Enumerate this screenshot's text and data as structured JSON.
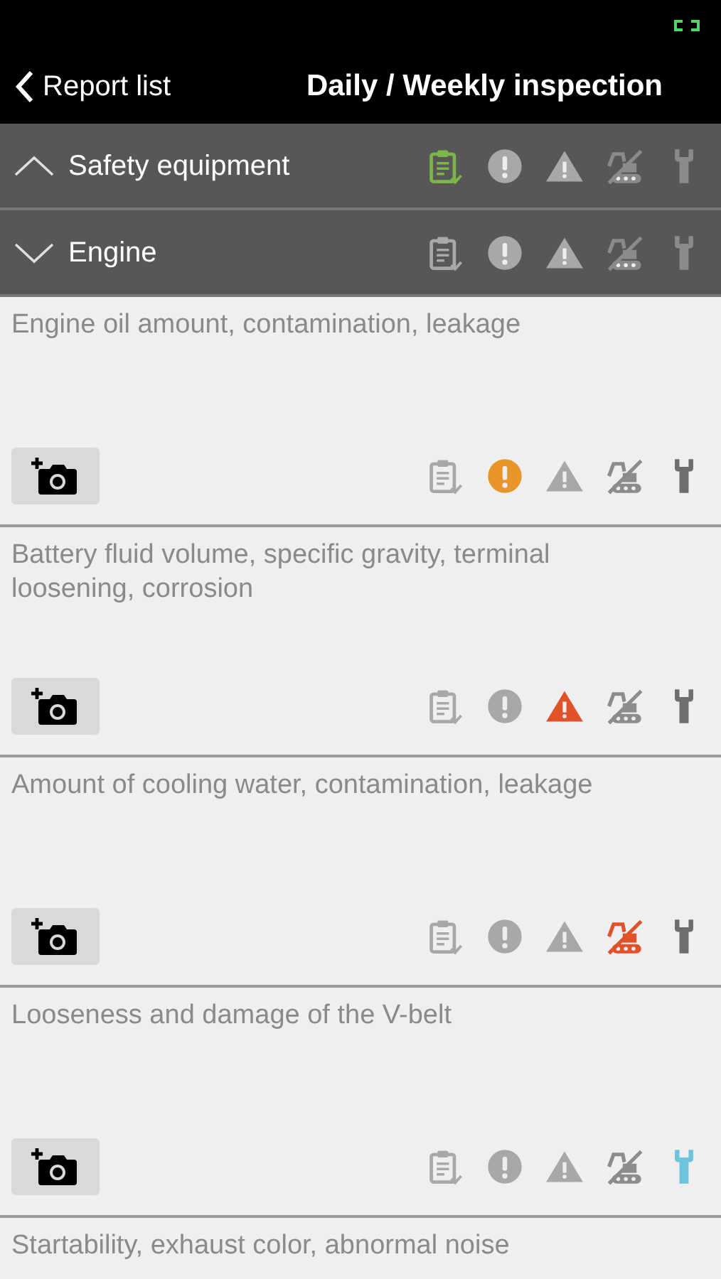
{
  "nav": {
    "back": "Report list",
    "title": "Daily / Weekly inspection"
  },
  "sections": [
    {
      "title": "Safety equipment",
      "expanded": true,
      "indicators": [
        {
          "kind": "ok",
          "selected": true
        },
        {
          "kind": "note",
          "selected": false
        },
        {
          "kind": "warning",
          "selected": false
        },
        {
          "kind": "out_of_service",
          "selected": false
        },
        {
          "kind": "repair",
          "selected": false
        }
      ]
    },
    {
      "title": "Engine",
      "expanded": false,
      "indicators": [
        {
          "kind": "ok",
          "selected": false
        },
        {
          "kind": "note",
          "selected": false
        },
        {
          "kind": "warning",
          "selected": false
        },
        {
          "kind": "out_of_service",
          "selected": false
        },
        {
          "kind": "repair",
          "selected": false
        }
      ],
      "items": [
        {
          "text": "Engine oil amount, contamination, leakage",
          "indicators": [
            {
              "kind": "ok",
              "selected": false
            },
            {
              "kind": "note",
              "selected": true
            },
            {
              "kind": "warning",
              "selected": false
            },
            {
              "kind": "out_of_service",
              "selected": false
            },
            {
              "kind": "repair",
              "selected": false
            }
          ]
        },
        {
          "text": "Battery fluid volume, specific gravity, terminal loosening, corrosion",
          "indicators": [
            {
              "kind": "ok",
              "selected": false
            },
            {
              "kind": "note",
              "selected": false
            },
            {
              "kind": "warning",
              "selected": true
            },
            {
              "kind": "out_of_service",
              "selected": false
            },
            {
              "kind": "repair",
              "selected": false
            }
          ]
        },
        {
          "text": "Amount of cooling water, contamination, leakage",
          "indicators": [
            {
              "kind": "ok",
              "selected": false
            },
            {
              "kind": "note",
              "selected": false
            },
            {
              "kind": "warning",
              "selected": false
            },
            {
              "kind": "out_of_service",
              "selected": true
            },
            {
              "kind": "repair",
              "selected": false
            }
          ]
        },
        {
          "text": "Looseness and damage of the V-belt",
          "indicators": [
            {
              "kind": "ok",
              "selected": false
            },
            {
              "kind": "note",
              "selected": false
            },
            {
              "kind": "warning",
              "selected": false
            },
            {
              "kind": "out_of_service",
              "selected": false
            },
            {
              "kind": "repair",
              "selected": true
            }
          ]
        },
        {
          "text": "Startability, exhaust color, abnormal noise"
        }
      ]
    }
  ]
}
